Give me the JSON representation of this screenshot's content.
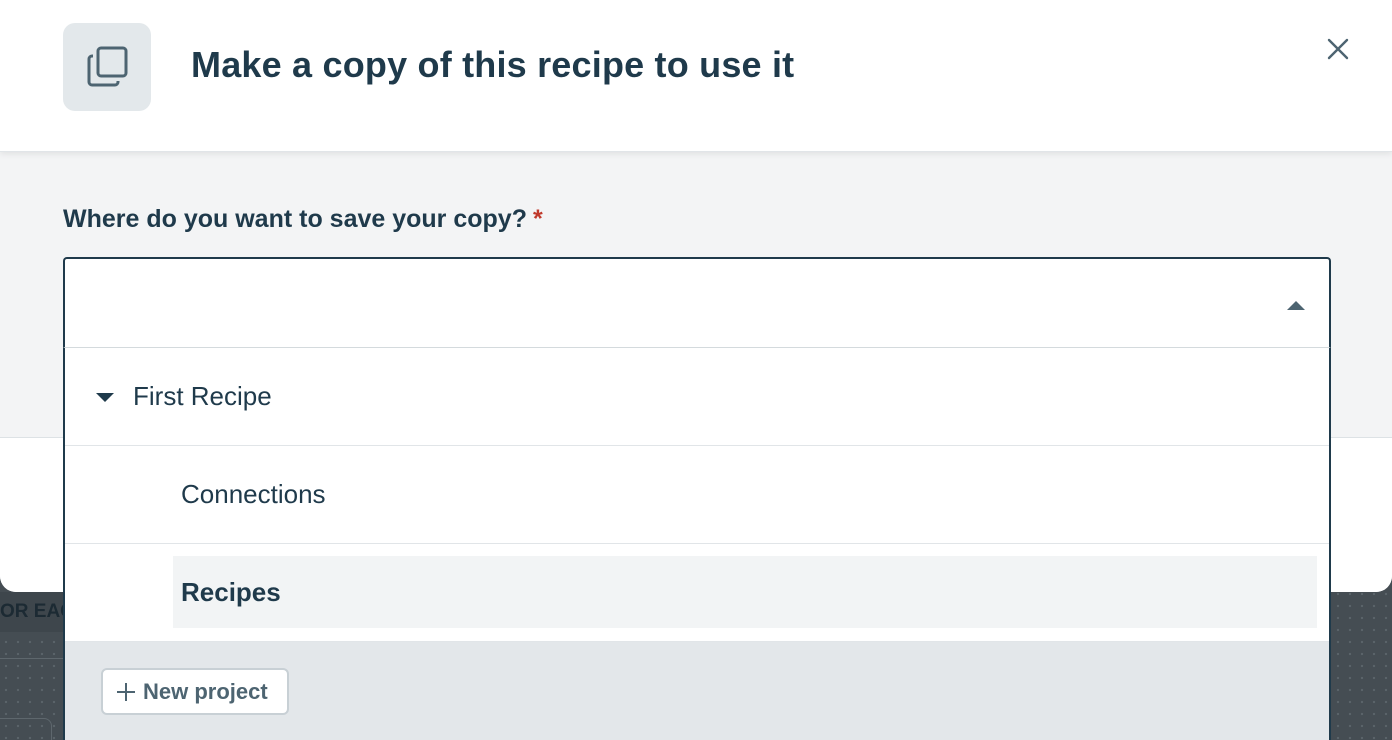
{
  "modal": {
    "title": "Make a copy of this recipe to use it",
    "header_icon": "copy-icon",
    "close_icon": "close-icon"
  },
  "form": {
    "location_label": "Where do you want to save your copy?",
    "required_marker": "*",
    "select_value": ""
  },
  "dropdown": {
    "folder": {
      "label": "First Recipe",
      "expanded": true
    },
    "children": [
      {
        "label": "Connections",
        "selected": false
      },
      {
        "label": "Recipes",
        "selected": true
      }
    ],
    "new_project_label": "New project"
  },
  "background": {
    "partial_text": "OR EAC"
  },
  "colors": {
    "text_primary": "#1f3a4b",
    "required": "#c0392b",
    "icon_tile": "#e3e8eb",
    "body_bg": "#f3f4f5",
    "dropdown_footer": "#e3e7ea"
  }
}
